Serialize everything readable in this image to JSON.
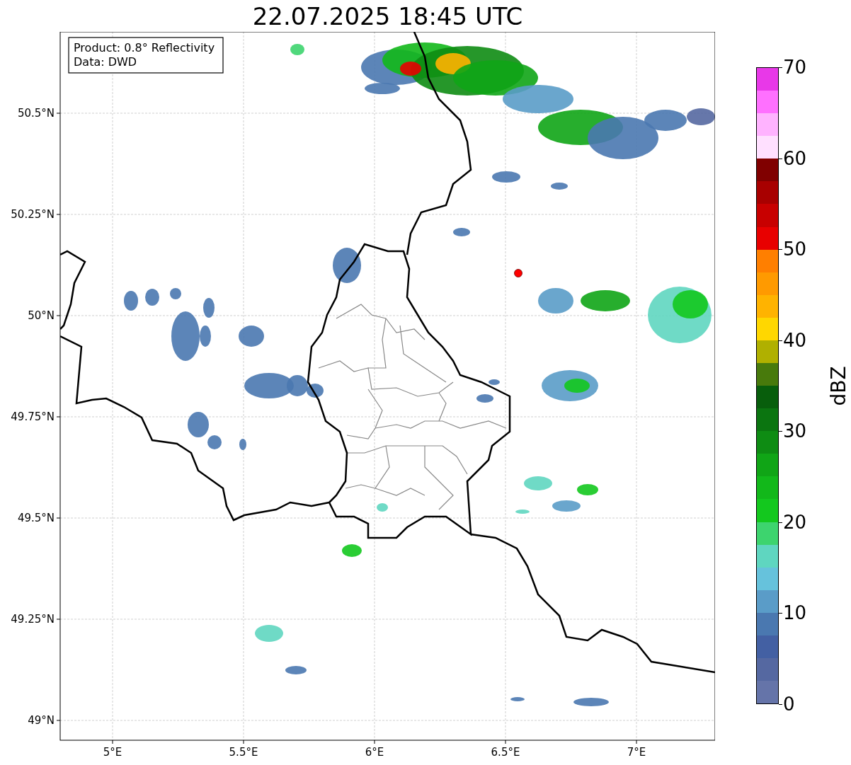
{
  "title": "22.07.2025 18:45 UTC",
  "info_box": [
    "Product: 0.8° Reflectivity",
    "Data: DWD"
  ],
  "map": {
    "x_ticks": [
      "5°E",
      "5.5°E",
      "6°E",
      "6.5°E",
      "7°E"
    ],
    "y_ticks": [
      "50.5°N",
      "50.25°N",
      "50°N",
      "49.75°N",
      "49.5°N",
      "49.25°N",
      "49°N"
    ]
  },
  "colorbar": {
    "label": "dBZ",
    "ticks": [
      "70",
      "60",
      "50",
      "40",
      "30",
      "20",
      "10",
      "0"
    ],
    "segments": [
      {
        "color": "#e838e8"
      },
      {
        "color": "#ff70ff"
      },
      {
        "color": "#ffb3ff"
      },
      {
        "color": "#ffe0ff"
      },
      {
        "color": "#800000"
      },
      {
        "color": "#a80000"
      },
      {
        "color": "#c80000"
      },
      {
        "color": "#e80000"
      },
      {
        "color": "#ff7f00"
      },
      {
        "color": "#ff9a00"
      },
      {
        "color": "#ffb300"
      },
      {
        "color": "#ffd700"
      },
      {
        "color": "#b0b000"
      },
      {
        "color": "#487a0c"
      },
      {
        "color": "#085e0c"
      },
      {
        "color": "#0b7510"
      },
      {
        "color": "#0e8c13"
      },
      {
        "color": "#10a516"
      },
      {
        "color": "#12b81a"
      },
      {
        "color": "#13c81e"
      },
      {
        "color": "#3dd46e"
      },
      {
        "color": "#5fd6c0"
      },
      {
        "color": "#66c2dc"
      },
      {
        "color": "#5a9cc8"
      },
      {
        "color": "#4a78b0"
      },
      {
        "color": "#4360a3"
      },
      {
        "color": "#5568a1"
      },
      {
        "color": "#6574a9"
      }
    ]
  }
}
